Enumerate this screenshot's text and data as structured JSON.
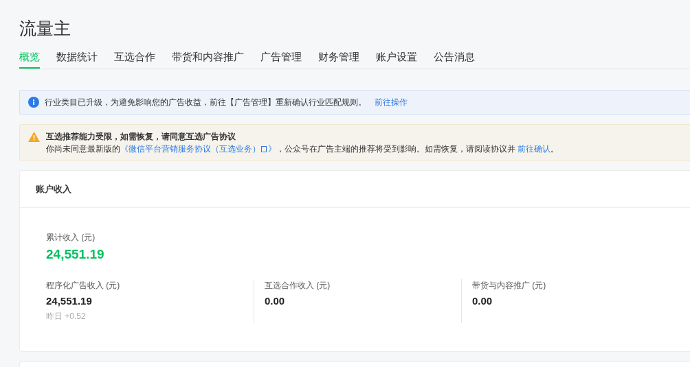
{
  "title": "流量主",
  "tabs": [
    {
      "label": "概览",
      "selected": true
    },
    {
      "label": "数据统计",
      "selected": false
    },
    {
      "label": "互选合作",
      "selected": false
    },
    {
      "label": "带货和内容推广",
      "selected": false
    },
    {
      "label": "广告管理",
      "selected": false
    },
    {
      "label": "财务管理",
      "selected": false
    },
    {
      "label": "账户设置",
      "selected": false
    },
    {
      "label": "公告消息",
      "selected": false
    }
  ],
  "info_notice": {
    "text": "行业类目已升级，为避免影响您的广告收益，前往【广告管理】重新确认行业匹配规则。",
    "action": "前往操作"
  },
  "warning_notice": {
    "title": "互选推荐能力受限，如需恢复，请同意互选广告协议",
    "text_before": "你尚未同意最新版的",
    "link": "《微信平台营销服务协议（互选业务）",
    "link_end": "》",
    "text_after": "，公众号在广告主端的推荐将受到影响。如需恢复，请阅读协议并",
    "action": "前往确认",
    "end": "。"
  },
  "income_card": {
    "title": "账户收入",
    "total_label": "累计收入 (元)",
    "total_value": "24,551.19",
    "items": [
      {
        "label": "程序化广告收入 (元)",
        "value": "24,551.19",
        "note": "昨日 +0.52"
      },
      {
        "label": "互选合作收入 (元)",
        "value": "0.00"
      },
      {
        "label": "带货与内容推广 (元)",
        "value": "0.00"
      }
    ]
  }
}
